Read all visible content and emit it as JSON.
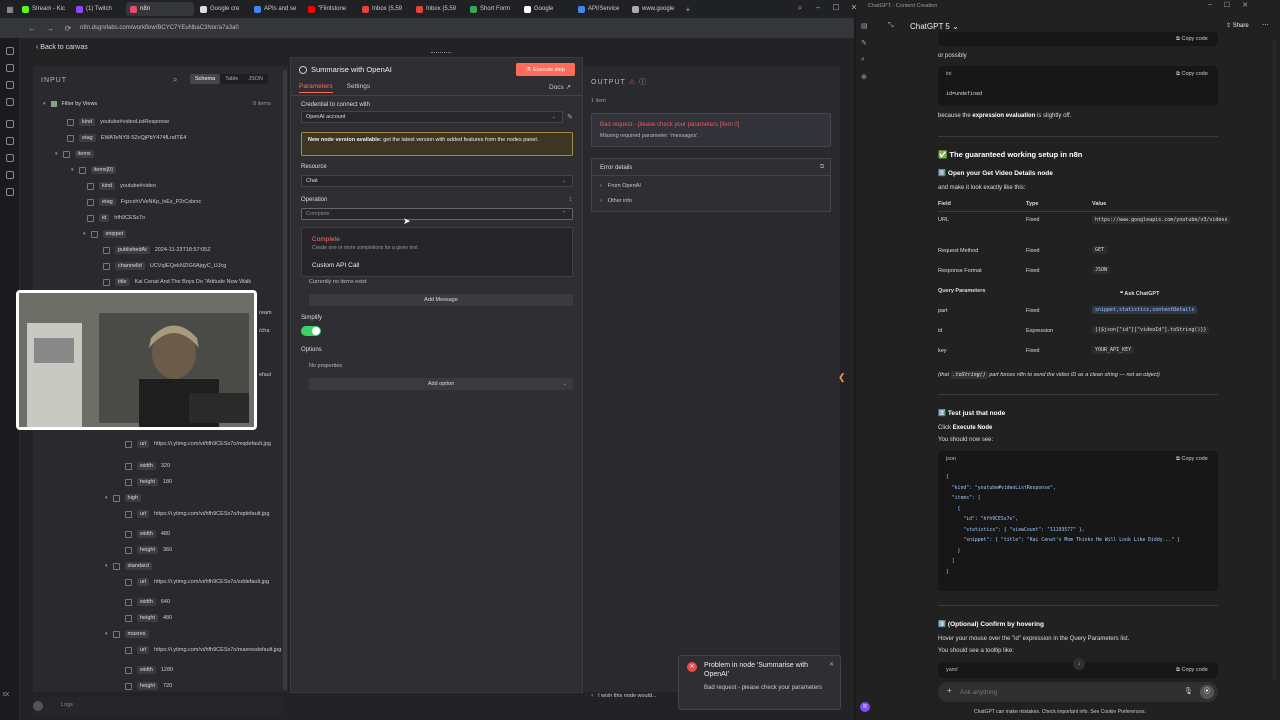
{
  "browser": {
    "tabs": [
      {
        "label": "Stream - Kic",
        "color": "#53fc18"
      },
      {
        "label": "(1) Twitch",
        "color": "#9146ff"
      },
      {
        "label": "n8n",
        "color": "#ea4b71",
        "active": true
      },
      {
        "label": "Google cre",
        "color": "#dddddd"
      },
      {
        "label": "APIs and se",
        "color": "#4285f4"
      },
      {
        "label": "\"Flintstone",
        "color": "#ff0000"
      },
      {
        "label": "Inbox (5,59",
        "color": "#ea4335"
      },
      {
        "label": "Inbox (5,59",
        "color": "#ea4335"
      },
      {
        "label": "Short Form",
        "color": "#34a853"
      },
      {
        "label": "Google",
        "color": "#ffffff"
      },
      {
        "label": "API/Service",
        "color": "#4285f4"
      },
      {
        "label": "www.google",
        "color": "#aaaaaa"
      }
    ],
    "url": "n8n.dsgnrlabs.com/workflow/BCYC7YEuNbaC3Nor/a7a3a0"
  },
  "n8n": {
    "back": "Back to canvas",
    "input": {
      "title": "INPUT",
      "views": [
        "Schema",
        "Table",
        "JSON"
      ],
      "active_view": "Schema",
      "filter_label": "Filter by Views",
      "item_count": "8 items",
      "rows": [
        {
          "key": "kind",
          "value": "youtube#videoListResponse"
        },
        {
          "key": "etag",
          "value": "EWATeNY8-S2vQjPbY474fLndTE4"
        },
        {
          "key": "items",
          "value": ""
        },
        {
          "key": "items[0]",
          "value": ""
        },
        {
          "key": "kind",
          "value": "youtube#video"
        },
        {
          "key": "etag",
          "value": "FqzcxhVVeNKp_lxEz_P2rCxbrxc"
        },
        {
          "key": "id",
          "value": "hfh9CESs7o"
        },
        {
          "key": "snippet",
          "value": ""
        },
        {
          "key": "publishedAt",
          "value": "2024-11-23T18:57:05Z"
        },
        {
          "key": "channelId",
          "value": "UCVqIEQekNZIG6AjqyC_UJcg"
        },
        {
          "key": "title",
          "value": "Kai Cenat And The Boys Do \"Attitude Now Walk"
        }
      ],
      "lower_rows": [
        {
          "key": "url",
          "value": "https://i.ytimg.com/vi/hfh9CESs7o/mqdefault.jpg"
        },
        {
          "key": "width",
          "value": "320"
        },
        {
          "key": "height",
          "value": "180"
        },
        {
          "key": "high",
          "value": ""
        },
        {
          "key": "url",
          "value": "https://i.ytimg.com/vi/hfh9CESs7o/hqdefault.jpg"
        },
        {
          "key": "width",
          "value": "480"
        },
        {
          "key": "height",
          "value": "360"
        },
        {
          "key": "standard",
          "value": ""
        },
        {
          "key": "url",
          "value": "https://i.ytimg.com/vi/hfh9CESs7o/sddefault.jpg"
        },
        {
          "key": "width",
          "value": "640"
        },
        {
          "key": "height",
          "value": "480"
        },
        {
          "key": "maxres",
          "value": ""
        },
        {
          "key": "url",
          "value": "https://i.ytimg.com/vi/hfh9CESs7o/maxresdefault.jpg"
        },
        {
          "key": "width",
          "value": "1280"
        },
        {
          "key": "height",
          "value": "720"
        }
      ],
      "partial_right": [
        "ream",
        "/cha",
        "efaul"
      ]
    },
    "node": {
      "title": "Summarise with OpenAI",
      "execute": "Execute step",
      "tabs": [
        "Parameters",
        "Settings"
      ],
      "docs": "Docs",
      "credential_label": "Credential to connect with",
      "credential_value": "OpenAI account",
      "notice_bold": "New node version available:",
      "notice_text": " get the latest version with added features from the nodes panel.",
      "resource_label": "Resource",
      "resource_value": "Chat",
      "operation_label": "Operation",
      "operation_value": "Complete",
      "dropdown": [
        {
          "title": "Complete",
          "desc": "Create one or more completions for a given text"
        },
        {
          "title": "Custom API Call",
          "desc": ""
        }
      ],
      "no_items": "Currently no items exist",
      "add_message": "Add Message",
      "simplify": "Simplify",
      "options": "Options",
      "no_props": "No properties",
      "add_option": "Add option"
    },
    "output": {
      "title": "OUTPUT",
      "count": "1 item",
      "error_title": "Bad request - please check your parameters [item 0]",
      "error_sub": "Missing required parameter: 'messages'.",
      "details": "Error details",
      "from": "From OpenAI",
      "other": "Other info"
    },
    "toast": {
      "title": "Problem in node 'Summarise with OpenAI'",
      "body": "Bad request - please check your parameters"
    },
    "wish": "I wish this node would...",
    "logs": "Logs"
  },
  "gpt": {
    "window_title": "ChatGPT - Content Creation",
    "model": "ChatGPT 5",
    "share": "Share",
    "copy_code": "Copy code",
    "or_possibly": "or possibly",
    "ini": "ini",
    "code1": "id=undefined",
    "because_pre": "because the ",
    "because_bold": "expression evaluation",
    "because_post": " is slightly off.",
    "h1": "✅ The guaranteed working setup in n8n",
    "h2": "1️⃣ Open your Get Video Details node",
    "make": "and make it look exactly like this:",
    "table_head": [
      "Field",
      "Type",
      "Value"
    ],
    "table_rows": [
      {
        "field": "URL",
        "type": "Fixed",
        "value": "https://www.googleapis.com/youtube/v3/videos"
      },
      {
        "field": "Request Method",
        "type": "Fixed",
        "value": "GET"
      },
      {
        "field": "Response Format",
        "type": "Fixed",
        "value": "JSON"
      },
      {
        "field": "Query Parameters",
        "type": "",
        "value": ""
      },
      {
        "field": "part",
        "type": "Fixed",
        "value": "snippet,statistics,contentDetails"
      },
      {
        "field": "id",
        "type": "Expression",
        "value": "{{$json[\"id\"][\"videoId\"].toString()}}"
      },
      {
        "field": "key",
        "type": "Fixed",
        "value": "YOUR_API_KEY"
      }
    ],
    "ask": "Ask ChatGPT",
    "that_pre": "(that ",
    "that_code": ".toString()",
    "that_post": " part forces n8n to send the video ID as a clean string — not an object)",
    "h3": "2️⃣ Test just that node",
    "click_pre": "Click ",
    "click_bold": "Execute Node",
    "should": "You should now see:",
    "json_lang": "json",
    "json_lines": [
      "{",
      "  \"kind\": \"youtube#videoListResponse\",",
      "  \"items\": [",
      "    {",
      "      \"id\": \"hfh9CESs7o\",",
      "      \"statistics\": { \"viewCount\": \"11193577\" },",
      "      \"snippet\": { \"title\": \"Kai Cenat's Mom Thinks He Will Look Like Diddy...\" }",
      "    }",
      "  ]",
      "}"
    ],
    "h4": "3️⃣ (Optional) Confirm by hovering",
    "hover": "Hover your mouse over the \"id\" expression in the Query Parameters list.",
    "tooltip": "You should see a tooltip like:",
    "yaml": "yaml",
    "ask_placeholder": "Ask anything",
    "footer": "ChatGPT can make mistakes. Check important info. See Cookie Preferences."
  },
  "colors": {
    "accent": "#ff6d5a",
    "success": "#3cd36a",
    "error": "#ea4b4b"
  }
}
